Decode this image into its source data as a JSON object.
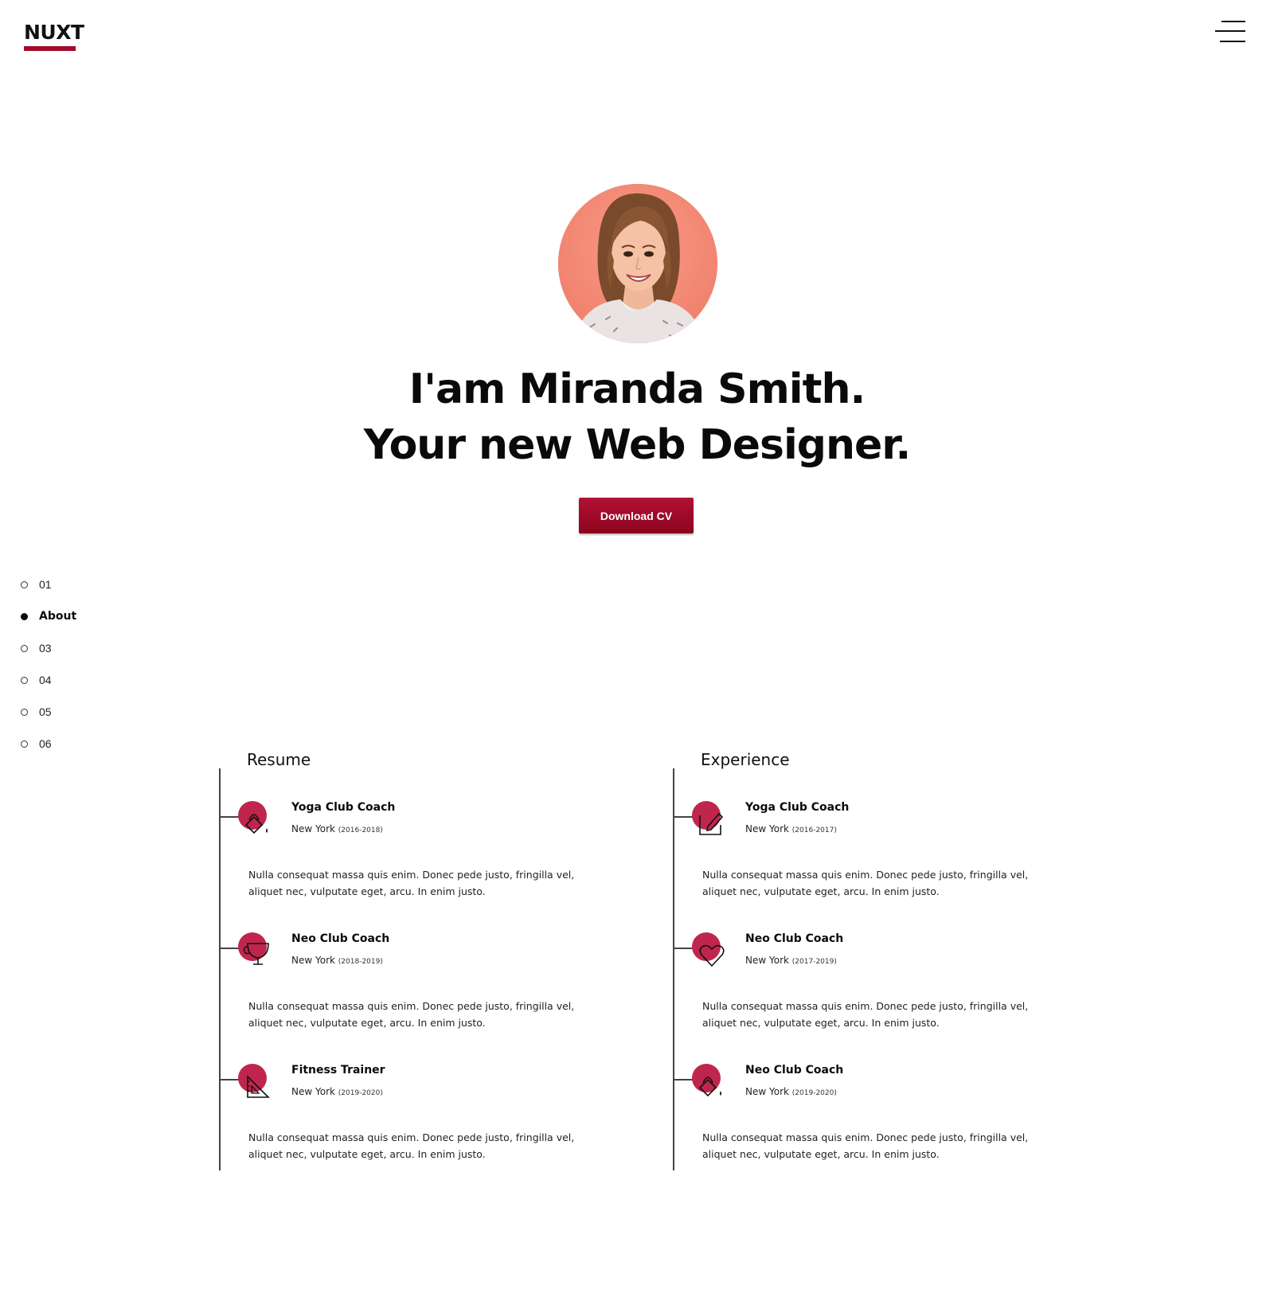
{
  "brand": {
    "logo_text": "NUXT",
    "accent_color": "#a30b2c"
  },
  "header": {
    "menu_icon": "hamburger-menu-icon"
  },
  "hero": {
    "avatar_alt": "Miranda Smith portrait",
    "line1": "I'am Miranda Smith.",
    "line2": "Your new Web Designer.",
    "cta_label": "Download CV"
  },
  "side_nav": {
    "items": [
      {
        "label": "01",
        "active": false
      },
      {
        "label": "About",
        "active": true
      },
      {
        "label": "03",
        "active": false
      },
      {
        "label": "04",
        "active": false
      },
      {
        "label": "05",
        "active": false
      },
      {
        "label": "06",
        "active": false
      }
    ]
  },
  "resume": {
    "title": "Resume",
    "entries": [
      {
        "title": "Yoga Club Coach",
        "location": "New York",
        "years": "(2016-2018)",
        "icon": "paint-bucket-icon",
        "description": "Nulla consequat massa quis enim. Donec pede justo, fringilla vel, aliquet nec, vulputate eget, arcu. In enim justo."
      },
      {
        "title": "Neo Club Coach",
        "location": "New York",
        "years": "(2018-2019)",
        "icon": "trophy-icon",
        "description": "Nulla consequat massa quis enim. Donec pede justo, fringilla vel, aliquet nec, vulputate eget, arcu. In enim justo."
      },
      {
        "title": "Fitness Trainer",
        "location": "New York",
        "years": "(2019-2020)",
        "icon": "set-square-icon",
        "description": "Nulla consequat massa quis enim. Donec pede justo, fringilla vel, aliquet nec, vulputate eget, arcu. In enim justo."
      }
    ]
  },
  "experience": {
    "title": "Experience",
    "entries": [
      {
        "title": "Yoga Club Coach",
        "location": "New York",
        "years": "(2016-2017)",
        "icon": "edit-pencil-icon",
        "description": "Nulla consequat massa quis enim. Donec pede justo, fringilla vel, aliquet nec, vulputate eget, arcu. In enim justo."
      },
      {
        "title": "Neo Club Coach",
        "location": "New York",
        "years": "(2017-2019)",
        "icon": "heart-icon",
        "description": "Nulla consequat massa quis enim. Donec pede justo, fringilla vel, aliquet nec, vulputate eget, arcu. In enim justo."
      },
      {
        "title": "Neo Club Coach",
        "location": "New York",
        "years": "(2019-2020)",
        "icon": "paint-bucket-icon",
        "description": "Nulla consequat massa quis enim. Donec pede justo, fringilla vel, aliquet nec, vulputate eget, arcu. In enim justo."
      }
    ]
  }
}
